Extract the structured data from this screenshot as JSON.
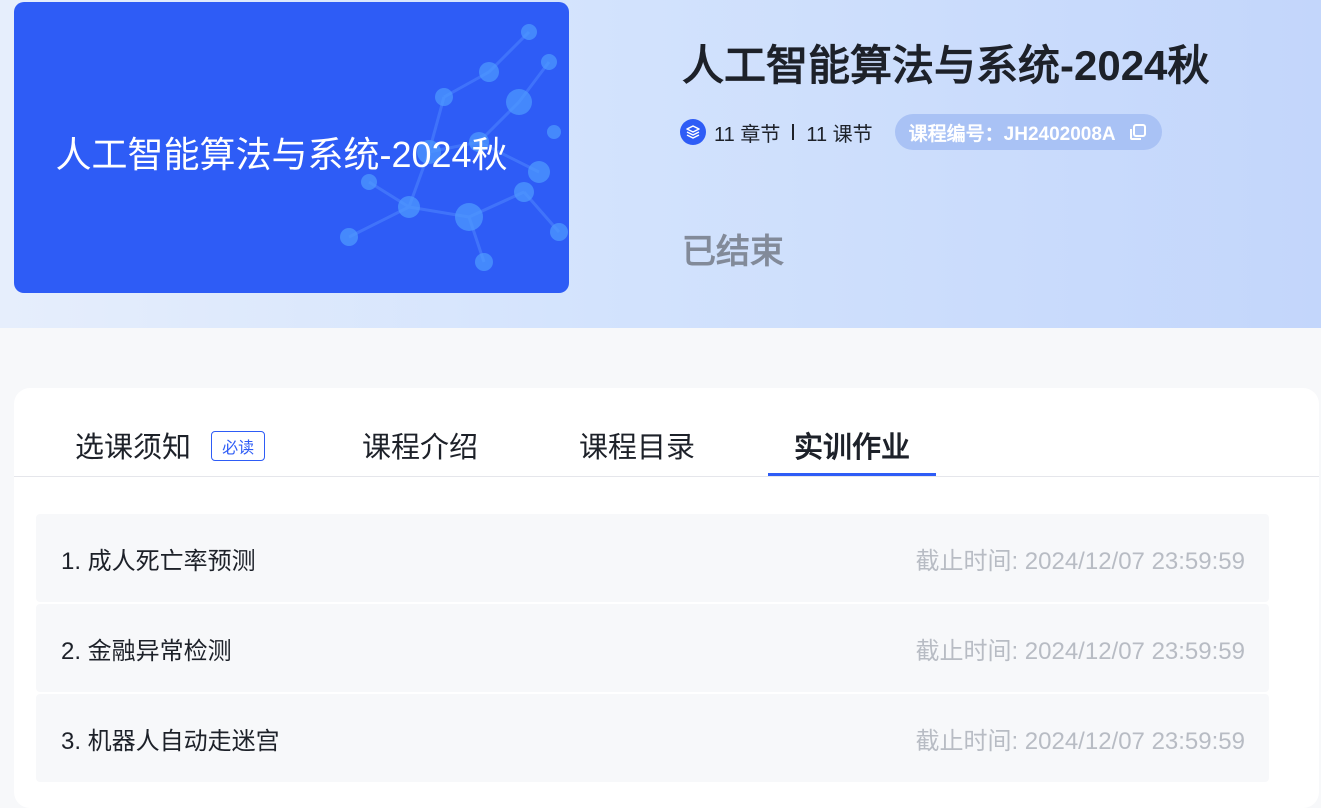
{
  "cover": {
    "title": "人工智能算法与系统-2024秋"
  },
  "course": {
    "title": "人工智能算法与系统-2024秋",
    "chapters": "11 章节",
    "lessons": "11 课节",
    "code_label": "课程编号：JH2402008A",
    "status": "已结束"
  },
  "tabs": [
    {
      "label": "选课须知",
      "badge": "必读"
    },
    {
      "label": "课程介绍"
    },
    {
      "label": "课程目录"
    },
    {
      "label": "实训作业"
    }
  ],
  "active_tab": "实训作业",
  "assignments": [
    {
      "title": "1. 成人死亡率预测",
      "deadline": "截止时间: 2024/12/07 23:59:59"
    },
    {
      "title": "2. 金融异常检测",
      "deadline": "截止时间: 2024/12/07 23:59:59"
    },
    {
      "title": "3. 机器人自动走迷宫",
      "deadline": "截止时间: 2024/12/07 23:59:59"
    }
  ],
  "icons": {
    "layers": "layers-icon",
    "copy": "copy-icon"
  },
  "colors": {
    "accent": "#2e5cf6",
    "title": "#1d2129",
    "muted": "#b8bcc4",
    "status": "#828a99"
  }
}
